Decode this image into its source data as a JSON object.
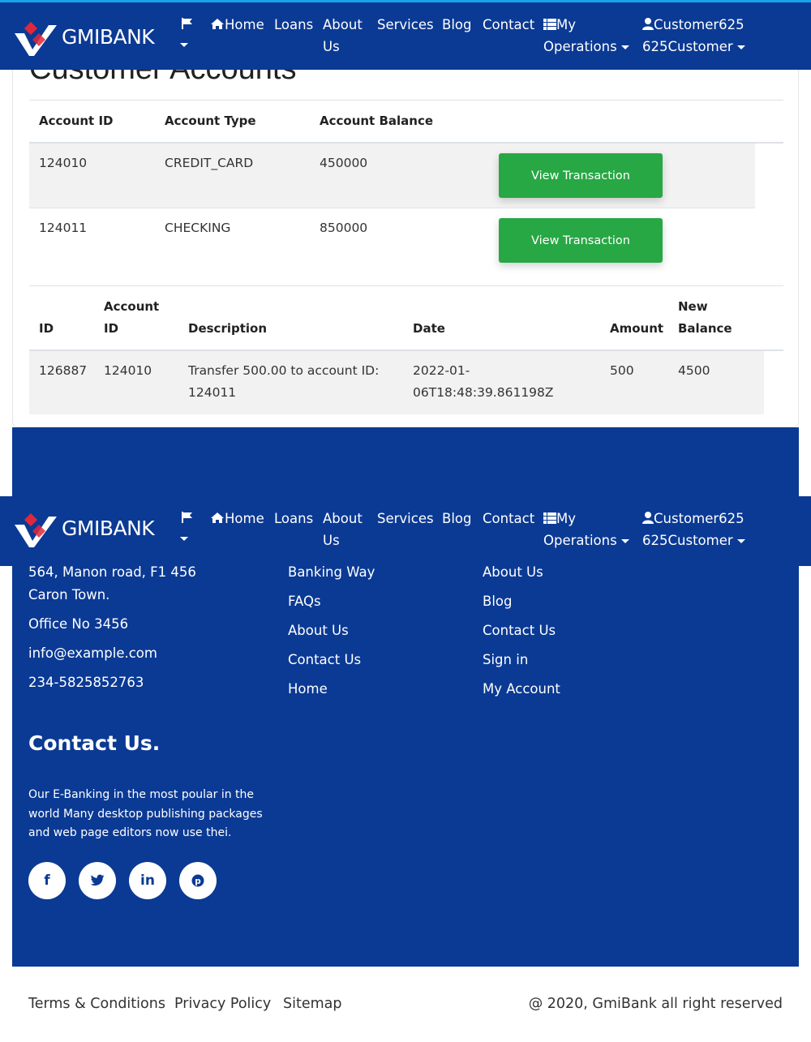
{
  "brand": {
    "name": "GMIBANK"
  },
  "nav": {
    "flag_icon": "flag-icon",
    "home": "Home",
    "loans": "Loans",
    "about_line1": "About",
    "about_line2": "Us",
    "services": "Services",
    "blog": "Blog",
    "contact": "Contact",
    "ops_line1": "My",
    "ops_line2": "Operations",
    "user_line1": "Customer625",
    "user_line2": "625Customer"
  },
  "page": {
    "title": "Customer Accounts"
  },
  "accounts_table": {
    "headers": {
      "account_id": "Account ID",
      "account_type": "Account Type",
      "account_balance": "Account Balance"
    },
    "rows": [
      {
        "id": "124010",
        "type": "CREDIT_CARD",
        "balance": "450000",
        "action": "View Transaction"
      },
      {
        "id": "124011",
        "type": "CHECKING",
        "balance": "850000",
        "action": "View Transaction"
      }
    ]
  },
  "transactions_table": {
    "headers": {
      "id": "ID",
      "account_id_l1": "Account",
      "account_id_l2": "ID",
      "description": "Description",
      "date": "Date",
      "amount": "Amount",
      "new_balance_l1": "New",
      "new_balance_l2": "Balance"
    },
    "rows": [
      {
        "id": "126887",
        "account_id": "124010",
        "desc_l1": "Transfer 500.00 to account ID:",
        "desc_l2": "124011",
        "date_l1": "2022-01-",
        "date_l2": "06T18:48:39.861198Z",
        "amount": "500",
        "new_balance": "4500"
      }
    ]
  },
  "footer": {
    "address_l1": "564, Manon road, F1 456",
    "address_l2": "Caron Town.",
    "office": "Office No 3456",
    "email": "info@example.com",
    "phone": "234-5825852763",
    "links_col1": [
      "Banking Way",
      "FAQs",
      "About Us",
      "Contact Us",
      "Home"
    ],
    "links_col2": [
      "About Us",
      "Blog",
      "Contact Us",
      "Sign in",
      "My Account"
    ],
    "contact_heading": "Contact Us.",
    "contact_desc": "Our E-Banking in the most poular in the world Many desktop publishing packages and web page editors now use thei.",
    "social": [
      {
        "icon": "facebook-icon",
        "glyph": "f"
      },
      {
        "icon": "twitter-icon",
        "glyph": "t"
      },
      {
        "icon": "linkedin-icon",
        "glyph": "in"
      },
      {
        "icon": "pinterest-icon",
        "glyph": "p"
      }
    ]
  },
  "bottom": {
    "terms": "Terms & Conditions",
    "privacy": "Privacy Policy",
    "sitemap": "Sitemap",
    "copyright": "@ 2020, GmiBank all right reserved"
  },
  "colors": {
    "primary": "#0b3a94",
    "accent_top": "#1aa3e8",
    "button": "#28a745",
    "logo_red": "#e0283c"
  }
}
